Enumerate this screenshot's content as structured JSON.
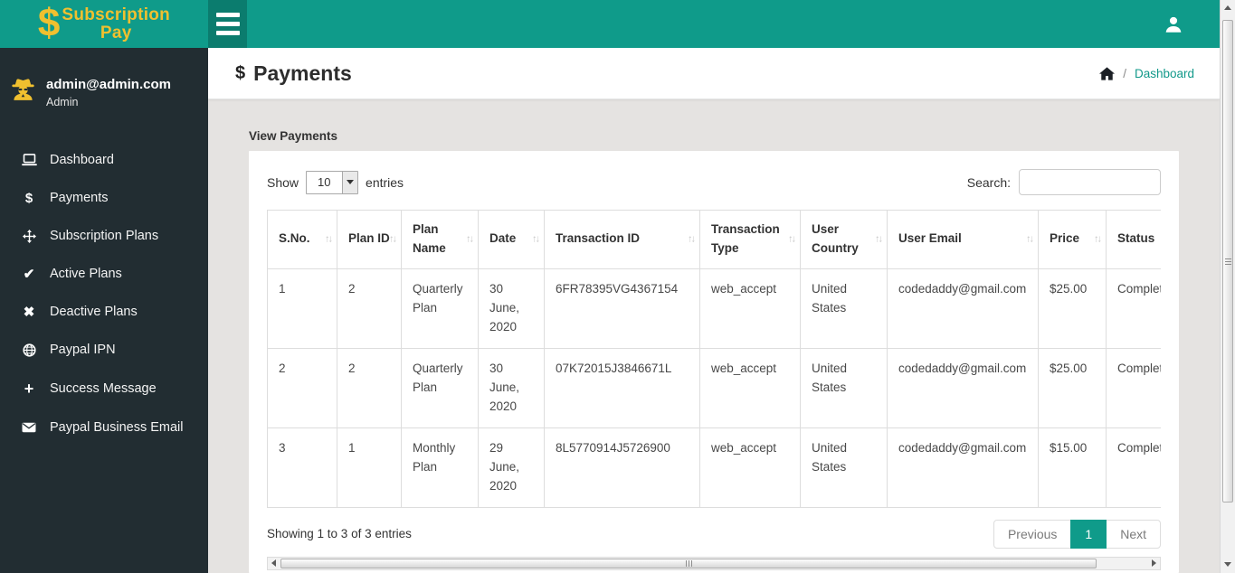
{
  "theme": {
    "topbar_teal": "#0f9b8a",
    "topbar_teal_dark": "#0b7c6e",
    "sidebar_bg": "#222d32",
    "brand_yellow": "#f0c02f",
    "link_teal": "#12998a",
    "content_bg": "#e5e3e1",
    "pagination_active_bg": "#0f9b8a"
  },
  "brand": {
    "symbol": "$",
    "line1": "Subscription",
    "line2": "Pay"
  },
  "sidebar": {
    "user": {
      "email": "admin@admin.com",
      "role": "Admin",
      "avatar_icon": "spy-avatar-icon"
    },
    "nav": [
      {
        "label": "Dashboard",
        "icon": "laptop-icon"
      },
      {
        "label": "Payments",
        "icon": "dollar-icon"
      },
      {
        "label": "Subscription Plans",
        "icon": "move-arrows-icon"
      },
      {
        "label": "Active Plans",
        "icon": "check-icon"
      },
      {
        "label": "Deactive Plans",
        "icon": "cross-icon"
      },
      {
        "label": "Paypal IPN",
        "icon": "globe-icon"
      },
      {
        "label": "Success Message",
        "icon": "plus-icon"
      },
      {
        "label": "Paypal Business Email",
        "icon": "envelope-icon"
      }
    ]
  },
  "page_header": {
    "title_symbol": "$",
    "title": "Payments",
    "breadcrumb": {
      "home_icon": "home-icon",
      "separator": "/",
      "link": "Dashboard"
    }
  },
  "panel": {
    "title": "View Payments",
    "length_control": {
      "prefix": "Show",
      "value": "10",
      "suffix": "entries"
    },
    "search": {
      "label": "Search:",
      "value": ""
    },
    "table": {
      "columns": [
        "S.No.",
        "Plan ID",
        "Plan Name",
        "Date",
        "Transaction ID",
        "Transaction Type",
        "User Country",
        "User Email",
        "Price",
        "Status"
      ],
      "rows": [
        [
          "1",
          "2",
          "Quarterly Plan",
          "30 June, 2020",
          "6FR78395VG4367154",
          "web_accept",
          "United States",
          "codedaddy@gmail.com",
          "$25.00",
          "Completed"
        ],
        [
          "2",
          "2",
          "Quarterly Plan",
          "30 June, 2020",
          "07K72015J3846671L",
          "web_accept",
          "United States",
          "codedaddy@gmail.com",
          "$25.00",
          "Completed"
        ],
        [
          "3",
          "1",
          "Monthly Plan",
          "29 June, 2020",
          "8L5770914J5726900",
          "web_accept",
          "United States",
          "codedaddy@gmail.com",
          "$15.00",
          "Completed"
        ]
      ]
    },
    "info": "Showing 1 to 3 of 3 entries",
    "pagination": {
      "previous": "Previous",
      "page": "1",
      "next": "Next"
    }
  }
}
